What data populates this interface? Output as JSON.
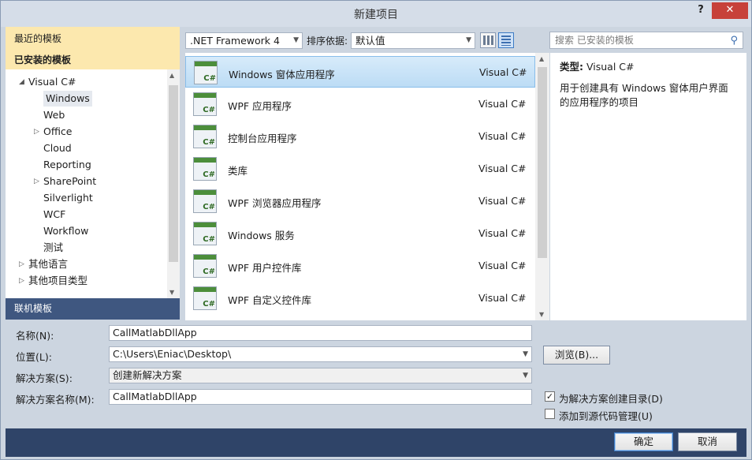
{
  "window": {
    "title": "新建项目",
    "help": "?",
    "close": "✕"
  },
  "left": {
    "recent": "最近的模板",
    "installed": "已安装的模板",
    "tree": [
      {
        "label": "Visual C#",
        "expander": "◢"
      },
      {
        "label": "Windows"
      },
      {
        "label": "Web"
      },
      {
        "label": "Office",
        "expander": "▷"
      },
      {
        "label": "Cloud"
      },
      {
        "label": "Reporting"
      },
      {
        "label": "SharePoint",
        "expander": "▷"
      },
      {
        "label": "Silverlight"
      },
      {
        "label": "WCF"
      },
      {
        "label": "Workflow"
      },
      {
        "label": "测试"
      },
      {
        "label": "其他语言",
        "expander": "▷"
      },
      {
        "label": "其他项目类型",
        "expander": "▷"
      }
    ],
    "online": "联机模板"
  },
  "toolbar": {
    "framework": ".NET Framework 4",
    "sort_label": "排序依据:",
    "sort_value": "默认值",
    "search_placeholder": "搜索 已安装的模板"
  },
  "templates": [
    {
      "name": "Windows 窗体应用程序",
      "lang": "Visual C#",
      "selected": true
    },
    {
      "name": "WPF 应用程序",
      "lang": "Visual C#"
    },
    {
      "name": "控制台应用程序",
      "lang": "Visual C#"
    },
    {
      "name": "类库",
      "lang": "Visual C#"
    },
    {
      "name": "WPF 浏览器应用程序",
      "lang": "Visual C#"
    },
    {
      "name": "Windows 服务",
      "lang": "Visual C#"
    },
    {
      "name": "WPF 用户控件库",
      "lang": "Visual C#"
    },
    {
      "name": "WPF 自定义控件库",
      "lang": "Visual C#"
    }
  ],
  "detail": {
    "type_label": "类型:",
    "type_value": "Visual C#",
    "description": "用于创建具有 Windows 窗体用户界面的应用程序的项目"
  },
  "form": {
    "name_label": "名称(N):",
    "name_value": "CallMatlabDllApp",
    "location_label": "位置(L):",
    "location_value": "C:\\Users\\Eniac\\Desktop\\",
    "browse": "浏览(B)...",
    "solution_label": "解决方案(S):",
    "solution_value": "创建新解决方案",
    "solution_name_label": "解决方案名称(M):",
    "solution_name_value": "CallMatlabDllApp",
    "create_dir": "为解决方案创建目录(D)",
    "create_dir_checked": true,
    "add_scc": "添加到源代码管理(U)",
    "add_scc_checked": false
  },
  "buttons": {
    "ok": "确定",
    "cancel": "取消"
  }
}
